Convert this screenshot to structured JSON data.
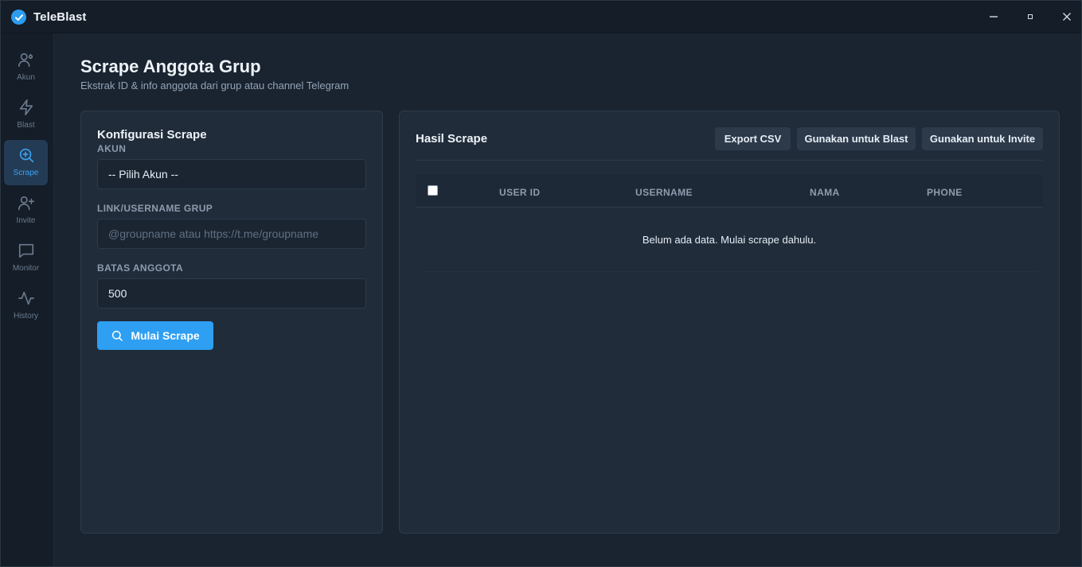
{
  "app": {
    "title": "TeleBlast"
  },
  "window_controls": {
    "minimize": "minimize-icon",
    "maximize": "maximize-icon",
    "close": "close-icon"
  },
  "sidebar": {
    "items": [
      {
        "label": "Akun",
        "icon": "users-icon",
        "active": false
      },
      {
        "label": "Blast",
        "icon": "lightning-icon",
        "active": false
      },
      {
        "label": "Scrape",
        "icon": "search-plus-icon",
        "active": true
      },
      {
        "label": "Invite",
        "icon": "user-plus-icon",
        "active": false
      },
      {
        "label": "Monitor",
        "icon": "message-icon",
        "active": false
      },
      {
        "label": "History",
        "icon": "activity-icon",
        "active": false
      }
    ]
  },
  "page": {
    "title": "Scrape Anggota Grup",
    "subtitle": "Ekstrak ID & info anggota dari grup atau channel Telegram"
  },
  "config": {
    "title": "Konfigurasi Scrape",
    "account_label": "AKUN",
    "account_value": "-- Pilih Akun --",
    "group_label": "LINK/USERNAME GRUP",
    "group_placeholder": "@groupname atau https://t.me/groupname",
    "limit_label": "BATAS ANGGOTA",
    "limit_value": "500",
    "start_button": "Mulai Scrape"
  },
  "results": {
    "title": "Hasil Scrape",
    "export_button": "Export CSV",
    "use_blast_button": "Gunakan untuk Blast",
    "use_invite_button": "Gunakan untuk Invite",
    "columns": [
      "USER ID",
      "USERNAME",
      "NAMA",
      "PHONE"
    ],
    "empty_message": "Belum ada data. Mulai scrape dahulu."
  },
  "colors": {
    "accent": "#2e9ff2",
    "background": "#1a2431",
    "panel": "#202c3a"
  }
}
